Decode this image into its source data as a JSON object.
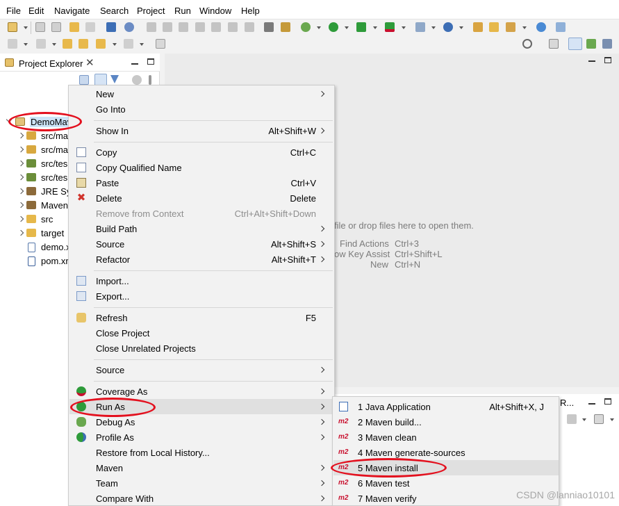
{
  "menubar": {
    "items": [
      "File",
      "Edit",
      "Navigate",
      "Search",
      "Project",
      "Run",
      "Window",
      "Help"
    ]
  },
  "toolbar": {
    "icons": [
      "new-icon",
      "save-icon",
      "save-all-icon",
      "undo-icon",
      "redo-icon",
      "terminal-icon",
      "search-icon",
      "debug-icon",
      "run-icon",
      "coverage-icon",
      "external-tools-icon",
      "new-package-icon",
      "new-class-icon",
      "open-type-icon",
      "open-task-icon",
      "globe-icon",
      "quick-access-search-icon",
      "perspective-icon"
    ]
  },
  "project_explorer": {
    "title": "Project Explorer",
    "tree": [
      {
        "label": "DemoMav",
        "icon": "project-icon",
        "color": "#c89a3c"
      },
      {
        "label": "src/ma",
        "icon": "source-folder-icon",
        "color": "#d8a83f"
      },
      {
        "label": "src/ma",
        "icon": "source-folder-icon",
        "color": "#d8a83f"
      },
      {
        "label": "src/tes",
        "icon": "source-folder-icon",
        "color": "#6b8e3a"
      },
      {
        "label": "src/tes",
        "icon": "source-folder-icon",
        "color": "#6b8e3a"
      },
      {
        "label": "JRE Sys",
        "icon": "library-icon",
        "color": "#8c6a3a"
      },
      {
        "label": "Maven",
        "icon": "library-icon",
        "color": "#8c6a3a"
      },
      {
        "label": "src",
        "icon": "folder-icon",
        "color": "#e6b84a"
      },
      {
        "label": "target",
        "icon": "folder-icon",
        "color": "#e6b84a"
      },
      {
        "label": "demo.x",
        "icon": "xml-file-icon",
        "color": "#5577aa"
      },
      {
        "label": "pom.xr",
        "icon": "maven-pom-icon",
        "color": "#3a5f9a"
      }
    ]
  },
  "editor": {
    "hints": [
      {
        "text": "file or drop files here to open them."
      },
      {
        "label": "Find Actions",
        "shortcut": "Ctrl+3"
      },
      {
        "label": "ow Key Assist",
        "shortcut": "Ctrl+Shift+L"
      },
      {
        "label": "New",
        "shortcut": "Ctrl+N"
      }
    ],
    "bottom_tab_fragment": "R..."
  },
  "context_menu": {
    "items": [
      {
        "label": "New",
        "shortcut": "",
        "submenu": true,
        "icon": "",
        "enabled": true
      },
      {
        "label": "Go Into",
        "shortcut": "",
        "submenu": false,
        "icon": "",
        "enabled": true
      },
      {
        "separator": true
      },
      {
        "label": "Show In",
        "shortcut": "Alt+Shift+W",
        "submenu": true,
        "icon": "",
        "enabled": true
      },
      {
        "separator": true
      },
      {
        "label": "Copy",
        "shortcut": "Ctrl+C",
        "submenu": false,
        "icon": "copy-icon",
        "enabled": true
      },
      {
        "label": "Copy Qualified Name",
        "shortcut": "",
        "submenu": false,
        "icon": "copy-qualified-name-icon",
        "enabled": true
      },
      {
        "label": "Paste",
        "shortcut": "Ctrl+V",
        "submenu": false,
        "icon": "paste-icon",
        "enabled": true
      },
      {
        "label": "Delete",
        "shortcut": "Delete",
        "submenu": false,
        "icon": "delete-icon",
        "enabled": true
      },
      {
        "label": "Remove from Context",
        "shortcut": "Ctrl+Alt+Shift+Down",
        "submenu": false,
        "icon": "",
        "enabled": false
      },
      {
        "label": "Build Path",
        "shortcut": "",
        "submenu": true,
        "icon": "",
        "enabled": true
      },
      {
        "label": "Source",
        "shortcut": "Alt+Shift+S",
        "submenu": true,
        "icon": "",
        "enabled": true
      },
      {
        "label": "Refactor",
        "shortcut": "Alt+Shift+T",
        "submenu": true,
        "icon": "",
        "enabled": true
      },
      {
        "separator": true
      },
      {
        "label": "Import...",
        "shortcut": "",
        "submenu": false,
        "icon": "import-icon",
        "enabled": true
      },
      {
        "label": "Export...",
        "shortcut": "",
        "submenu": false,
        "icon": "export-icon",
        "enabled": true
      },
      {
        "separator": true
      },
      {
        "label": "Refresh",
        "shortcut": "F5",
        "submenu": false,
        "icon": "refresh-icon",
        "enabled": true
      },
      {
        "label": "Close Project",
        "shortcut": "",
        "submenu": false,
        "icon": "",
        "enabled": true
      },
      {
        "label": "Close Unrelated Projects",
        "shortcut": "",
        "submenu": false,
        "icon": "",
        "enabled": true
      },
      {
        "separator": true
      },
      {
        "label": "Source",
        "shortcut": "",
        "submenu": true,
        "icon": "",
        "enabled": true
      },
      {
        "separator": true
      },
      {
        "label": "Coverage As",
        "shortcut": "",
        "submenu": true,
        "icon": "coverage-icon",
        "enabled": true
      },
      {
        "label": "Run As",
        "shortcut": "",
        "submenu": true,
        "icon": "run-icon",
        "enabled": true,
        "highlighted": true
      },
      {
        "label": "Debug As",
        "shortcut": "",
        "submenu": true,
        "icon": "debug-icon",
        "enabled": true
      },
      {
        "label": "Profile As",
        "shortcut": "",
        "submenu": true,
        "icon": "profile-icon",
        "enabled": true
      },
      {
        "label": "Restore from Local History...",
        "shortcut": "",
        "submenu": false,
        "icon": "",
        "enabled": true
      },
      {
        "label": "Maven",
        "shortcut": "",
        "submenu": true,
        "icon": "",
        "enabled": true
      },
      {
        "label": "Team",
        "shortcut": "",
        "submenu": true,
        "icon": "",
        "enabled": true
      },
      {
        "label": "Compare With",
        "shortcut": "",
        "submenu": true,
        "icon": "",
        "enabled": true
      }
    ]
  },
  "run_as_submenu": {
    "items": [
      {
        "label": "1 Java Application",
        "shortcut": "Alt+Shift+X, J",
        "icon": "java-app-icon"
      },
      {
        "label": "2 Maven build...",
        "shortcut": "",
        "icon": "m2-icon"
      },
      {
        "label": "3 Maven clean",
        "shortcut": "",
        "icon": "m2-icon"
      },
      {
        "label": "4 Maven generate-sources",
        "shortcut": "",
        "icon": "m2-icon"
      },
      {
        "label": "5 Maven install",
        "shortcut": "",
        "icon": "m2-icon",
        "highlighted": true
      },
      {
        "label": "6 Maven test",
        "shortcut": "",
        "icon": "m2-icon"
      },
      {
        "label": "7 Maven verify",
        "shortcut": "",
        "icon": "m2-icon"
      }
    ],
    "m2_badge": "m2"
  },
  "watermark": "CSDN @lanniao10101",
  "colors": {
    "annotation_red": "#e3101e",
    "highlight": "#e0e0e0",
    "m2_red": "#c8102e",
    "run_green": "#2e9b3a"
  }
}
